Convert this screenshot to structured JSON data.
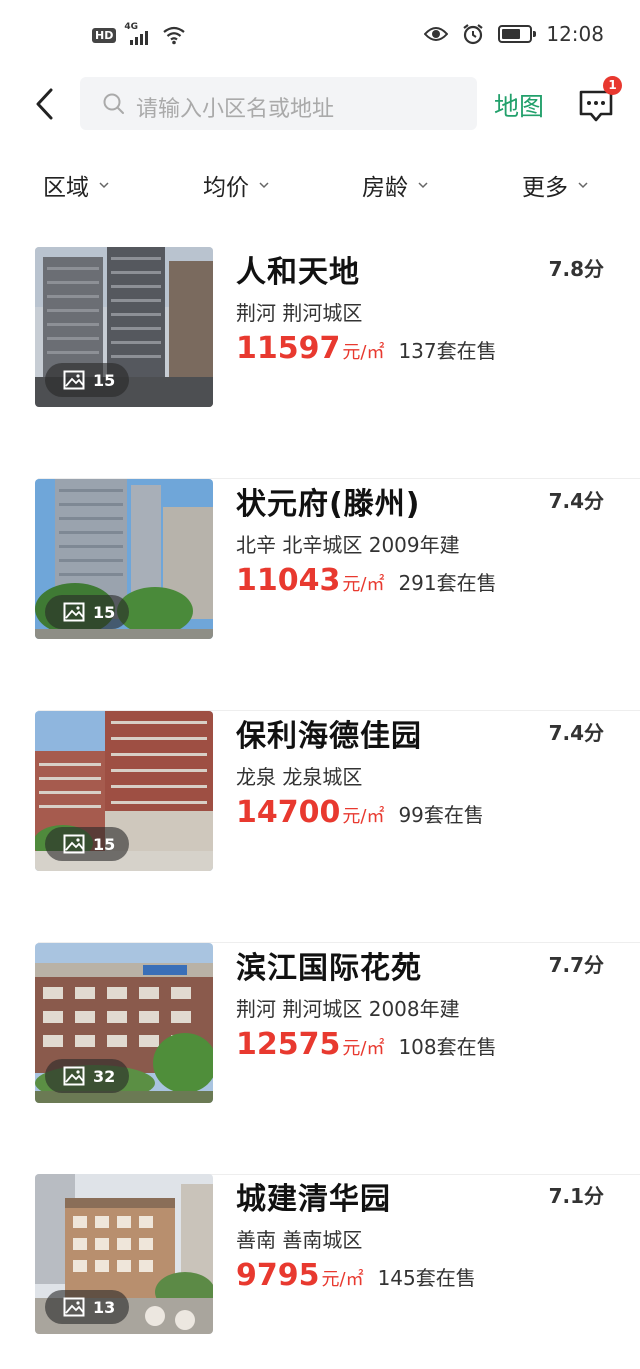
{
  "status_bar": {
    "hd": "HD",
    "network": "4G",
    "time": "12:08"
  },
  "search": {
    "placeholder": "请输入小区名或地址",
    "map_label": "地图",
    "message_badge": "1"
  },
  "filters": [
    {
      "label": "区域"
    },
    {
      "label": "均价"
    },
    {
      "label": "房龄"
    },
    {
      "label": "更多"
    }
  ],
  "colors": {
    "accent_green": "#22a06b",
    "price_red": "#e8392f",
    "badge_red": "#e8382f"
  },
  "listings": [
    {
      "name": "人和天地",
      "score": "7.8分",
      "location": "荆河  荆河城区",
      "price": "11597",
      "unit": "元/㎡",
      "on_sale": "137套在售",
      "photo_count": "15"
    },
    {
      "name": "状元府(滕州)",
      "score": "7.4分",
      "location": "北辛  北辛城区  2009年建",
      "price": "11043",
      "unit": "元/㎡",
      "on_sale": "291套在售",
      "photo_count": "15"
    },
    {
      "name": "保利海德佳园",
      "score": "7.4分",
      "location": "龙泉  龙泉城区",
      "price": "14700",
      "unit": "元/㎡",
      "on_sale": "99套在售",
      "photo_count": "15"
    },
    {
      "name": "滨江国际花苑",
      "score": "7.7分",
      "location": "荆河  荆河城区  2008年建",
      "price": "12575",
      "unit": "元/㎡",
      "on_sale": "108套在售",
      "photo_count": "32"
    },
    {
      "name": "城建清华园",
      "score": "7.1分",
      "location": "善南  善南城区",
      "price": "9795",
      "unit": "元/㎡",
      "on_sale": "145套在售",
      "photo_count": "13"
    }
  ]
}
